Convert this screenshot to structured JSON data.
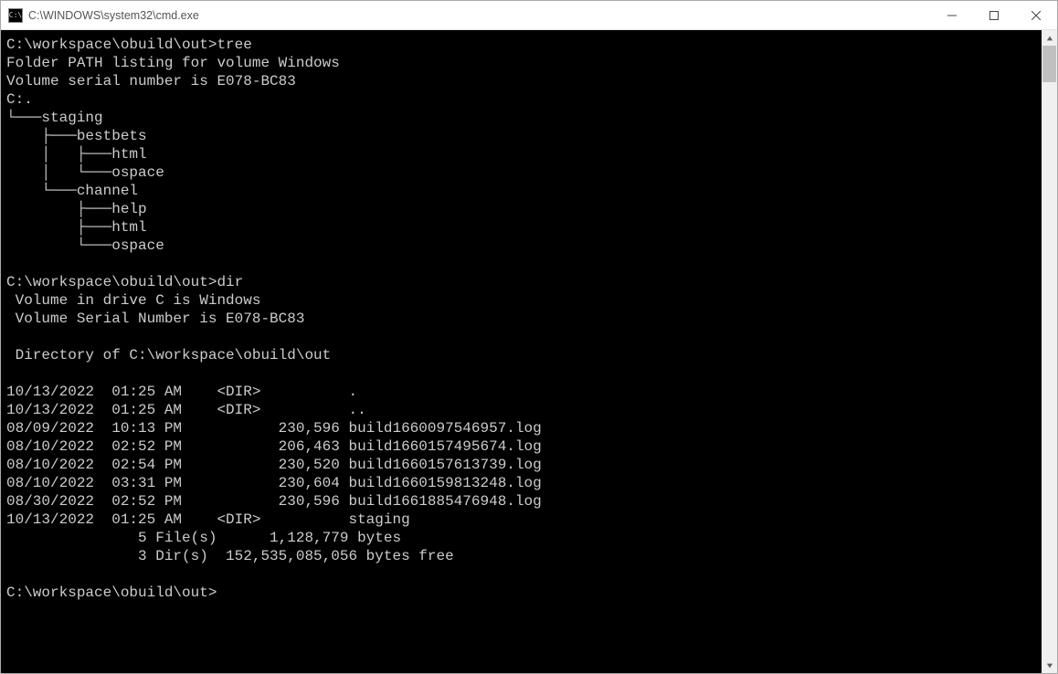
{
  "window": {
    "title": "C:\\WINDOWS\\system32\\cmd.exe"
  },
  "terminal": {
    "prompt1": "C:\\workspace\\obuild\\out>",
    "cmd1": "tree",
    "tree_header1": "Folder PATH listing for volume Windows",
    "tree_header2": "Volume serial number is E078-BC83",
    "tree_root": "C:.",
    "tree_l1": "└───staging",
    "tree_l2": "    ├───bestbets",
    "tree_l3": "    │   ├───html",
    "tree_l4": "    │   └───ospace",
    "tree_l5": "    └───channel",
    "tree_l6": "        ├───help",
    "tree_l7": "        ├───html",
    "tree_l8": "        └───ospace",
    "blank": "",
    "prompt2": "C:\\workspace\\obuild\\out>",
    "cmd2": "dir",
    "dir_h1": " Volume in drive C is Windows",
    "dir_h2": " Volume Serial Number is E078-BC83",
    "dir_h3": " Directory of C:\\workspace\\obuild\\out",
    "dir_r1": "10/13/2022  01:25 AM    <DIR>          .",
    "dir_r2": "10/13/2022  01:25 AM    <DIR>          ..",
    "dir_r3": "08/09/2022  10:13 PM           230,596 build1660097546957.log",
    "dir_r4": "08/10/2022  02:52 PM           206,463 build1660157495674.log",
    "dir_r5": "08/10/2022  02:54 PM           230,520 build1660157613739.log",
    "dir_r6": "08/10/2022  03:31 PM           230,604 build1660159813248.log",
    "dir_r7": "08/30/2022  02:52 PM           230,596 build1661885476948.log",
    "dir_r8": "10/13/2022  01:25 AM    <DIR>          staging",
    "dir_f1": "               5 File(s)      1,128,779 bytes",
    "dir_f2": "               3 Dir(s)  152,535,085,056 bytes free",
    "prompt3": "C:\\workspace\\obuild\\out>"
  }
}
